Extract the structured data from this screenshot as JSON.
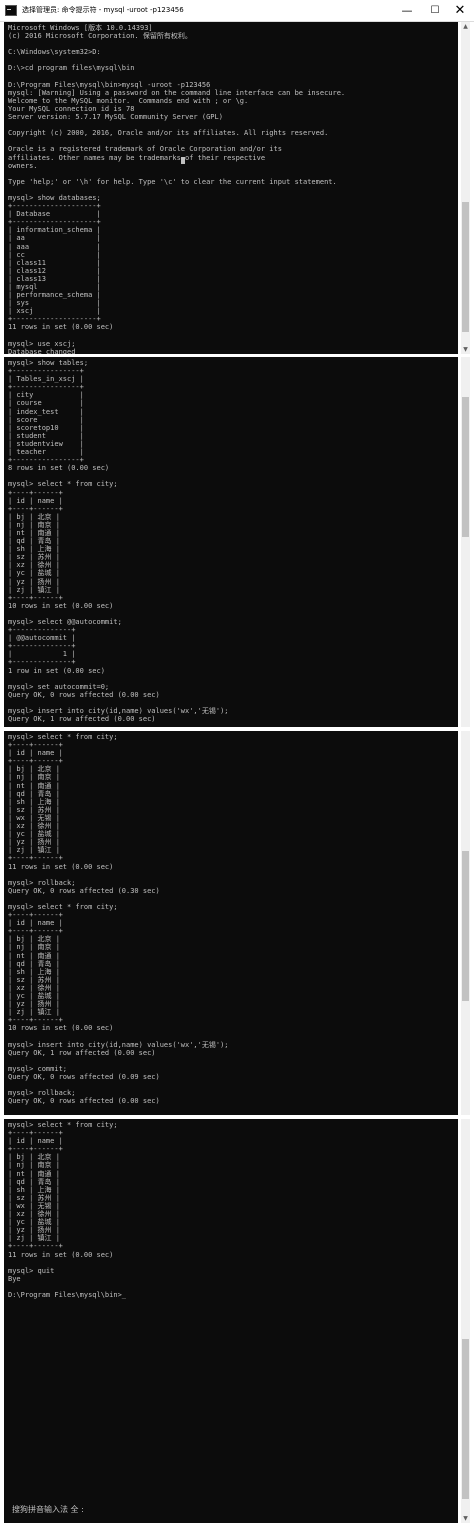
{
  "window": {
    "title": "选择管理员: 命令提示符 - mysql -uroot -p123456",
    "minimize_glyph": "—",
    "maximize_glyph": "☐",
    "close_glyph": "✕",
    "icon": "cmd-icon"
  },
  "panels": [
    {
      "text": "Microsoft Windows [版本 10.0.14393]\n(c) 2016 Microsoft Corporation. 保留所有权利。\n\nC:\\Windows\\system32>D:\n\nD:\\>cd program files\\mysql\\bin\n\nD:\\Program Files\\mysql\\bin>mysql -uroot -p123456\nmysql: [Warning] Using a password on the command line interface can be insecure.\nWelcome to the MySQL monitor.  Commands end with ; or \\g.\nYour MySQL connection id is 78\nServer version: 5.7.17 MySQL Community Server (GPL)\n\nCopyright (c) 2000, 2016, Oracle and/or its affiliates. All rights reserved.\n\nOracle is a registered trademark of Oracle Corporation and/or its\naffiliates. Other names may be trademarks of their respective\nowners.\n\nType 'help;' or '\\h' for help. Type '\\c' to clear the current input statement.\n\nmysql> show databases;\n+--------------------+\n| Database           |\n+--------------------+\n| information_schema |\n| aa                 |\n| aaa                |\n| cc                 |\n| class11            |\n| class12            |\n| class13            |\n| mysql              |\n| performance_schema |\n| sys                |\n| xscj               |\n+--------------------+\n11 rows in set (0.00 sec)\n\nmysql> use xscj;\nDatabase changed"
    },
    {
      "text": "mysql> show tables;\n+----------------+\n| Tables_in_xscj |\n+----------------+\n| city           |\n| course         |\n| index_test     |\n| score          |\n| scoretop10     |\n| student        |\n| studentview    |\n| teacher        |\n+----------------+\n8 rows in set (0.00 sec)\n\nmysql> select * from city;\n+----+------+\n| id | name |\n+----+------+\n| bj | 北京 |\n| nj | 南京 |\n| nt | 南通 |\n| qd | 青岛 |\n| sh | 上海 |\n| sz | 苏州 |\n| xz | 徐州 |\n| yc | 盐城 |\n| yz | 扬州 |\n| zj | 镇江 |\n+----+------+\n10 rows in set (0.00 sec)\n\nmysql> select @@autocommit;\n+--------------+\n| @@autocommit |\n+--------------+\n|            1 |\n+--------------+\n1 row in set (0.00 sec)\n\nmysql> set autocommit=0;\nQuery OK, 0 rows affected (0.00 sec)\n\nmysql> insert into city(id,name) values('wx','无锡');\nQuery OK, 1 row affected (0.00 sec)"
    },
    {
      "text": "mysql> select * from city;\n+----+------+\n| id | name |\n+----+------+\n| bj | 北京 |\n| nj | 南京 |\n| nt | 南通 |\n| qd | 青岛 |\n| sh | 上海 |\n| sz | 苏州 |\n| wx | 无锡 |\n| xz | 徐州 |\n| yc | 盐城 |\n| yz | 扬州 |\n| zj | 镇江 |\n+----+------+\n11 rows in set (0.00 sec)\n\nmysql> rollback;\nQuery OK, 0 rows affected (0.30 sec)\n\nmysql> select * from city;\n+----+------+\n| id | name |\n+----+------+\n| bj | 北京 |\n| nj | 南京 |\n| nt | 南通 |\n| qd | 青岛 |\n| sh | 上海 |\n| sz | 苏州 |\n| xz | 徐州 |\n| yc | 盐城 |\n| yz | 扬州 |\n| zj | 镇江 |\n+----+------+\n10 rows in set (0.00 sec)\n\nmysql> insert into city(id,name) values('wx','无锡');\nQuery OK, 1 row affected (0.00 sec)\n\nmysql> commit;\nQuery OK, 0 rows affected (0.09 sec)\n\nmysql> rollback;\nQuery OK, 0 rows affected (0.00 sec)"
    },
    {
      "text": "mysql> select * from city;\n+----+------+\n| id | name |\n+----+------+\n| bj | 北京 |\n| nj | 南京 |\n| nt | 南通 |\n| qd | 青岛 |\n| sh | 上海 |\n| sz | 苏州 |\n| wx | 无锡 |\n| xz | 徐州 |\n| yc | 盐城 |\n| yz | 扬州 |\n| zj | 镇江 |\n+----+------+\n11 rows in set (0.00 sec)\n\nmysql> quit\nBye\n\nD:\\Program Files\\mysql\\bin>_"
    }
  ],
  "ime_status": "搜狗拼音输入法 全 :"
}
